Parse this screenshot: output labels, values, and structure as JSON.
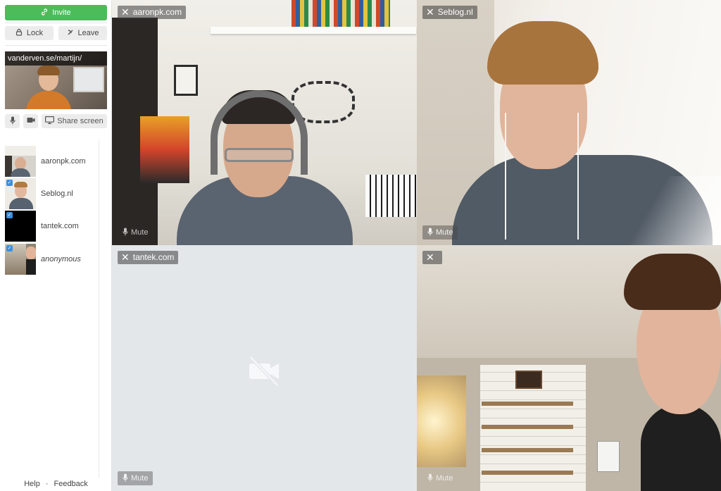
{
  "sidebar": {
    "invite_label": "Invite",
    "lock_label": "Lock",
    "leave_label": "Leave",
    "self_url": "vanderven.se/martijn/",
    "share_label": "Share screen",
    "participants": [
      {
        "label": "aaronpk.com",
        "checked": false
      },
      {
        "label": "Seblog.nl",
        "checked": true
      },
      {
        "label": "tantek.com",
        "checked": true
      },
      {
        "label": "anonymous",
        "checked": true
      }
    ],
    "footer": {
      "help": "Help",
      "separator": "·",
      "feedback": "Feedback"
    }
  },
  "tiles": {
    "aaron": {
      "name": "aaronpk.com",
      "mute": "Mute"
    },
    "seblog": {
      "name": "Seblog.nl",
      "mute": "Mute"
    },
    "tantek": {
      "name": "tantek.com",
      "mute": "Mute"
    },
    "anon": {
      "name": "",
      "mute": "Mute"
    }
  },
  "colors": {
    "invite": "#4cbb5a",
    "check": "#3a8fe0"
  },
  "icons": [
    "link-icon",
    "lock-icon",
    "leave-icon",
    "mic-icon",
    "camera-icon",
    "screen-icon",
    "close-icon",
    "camera-off-icon"
  ]
}
